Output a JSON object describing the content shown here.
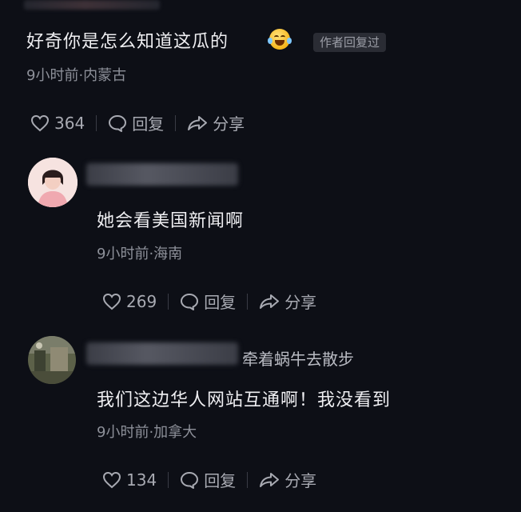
{
  "comments": [
    {
      "text": "好奇你是怎么知道这瓜的",
      "author_badge": "作者回复过",
      "meta": "9小时前·内蒙古",
      "likes": "364",
      "reply_label": "回复",
      "share_label": "分享"
    },
    {
      "text": "她会看美国新闻啊",
      "meta": "9小时前·海南",
      "likes": "269",
      "reply_label": "回复",
      "share_label": "分享"
    },
    {
      "username": "牵着蜗牛去散步",
      "text": "我们这边华人网站互通啊！我没看到",
      "meta": "9小时前·加拿大",
      "likes": "134",
      "reply_label": "回复",
      "share_label": "分享"
    }
  ],
  "icons": {
    "like": "heart-icon",
    "reply": "speech-bubble-icon",
    "share": "share-arrow-icon",
    "emoji": "rolling-laughing-emoji-icon"
  },
  "colors": {
    "background": "#0d0f16",
    "text": "#efeff2",
    "meta": "#8d9099",
    "action": "#a8aab2"
  }
}
